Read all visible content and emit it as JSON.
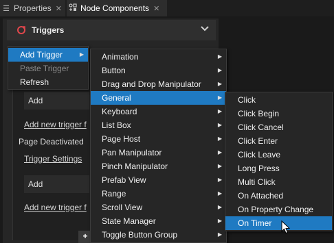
{
  "tabs": [
    {
      "label": "Properties",
      "icon": "list-icon",
      "close": "✕"
    },
    {
      "label": "Node Components",
      "icon": "node-components-icon",
      "close": "✕"
    }
  ],
  "section": {
    "title": "Triggers",
    "icon": "trigger-icon"
  },
  "panel": {
    "add_label_1": "Add",
    "add_new_trigger_1": "Add new trigger f",
    "page_deactivated": "Page Deactivated",
    "trigger_settings": "Trigger Settings",
    "add_label_2": "Add",
    "add_new_trigger_2": "Add new trigger f",
    "add_button": "+"
  },
  "context_menu": {
    "items": [
      {
        "label": "Add Trigger",
        "selected": true,
        "submenu": true
      },
      {
        "label": "Paste Trigger",
        "disabled": true
      },
      {
        "label": "Refresh"
      }
    ]
  },
  "trigger_menu": {
    "items": [
      "Animation",
      "Button",
      "Drag and Drop Manipulator",
      "General",
      "Keyboard",
      "List Box",
      "Page Host",
      "Pan Manipulator",
      "Pinch Manipulator",
      "Prefab View",
      "Range",
      "Scroll View",
      "State Manager",
      "Toggle Button Group"
    ],
    "selected": "General"
  },
  "general_menu": {
    "items": [
      "Click",
      "Click Begin",
      "Click Cancel",
      "Click Enter",
      "Click Leave",
      "Long Press",
      "Multi Click",
      "On Attached",
      "On Property Change",
      "On Timer"
    ],
    "selected": "On Timer"
  },
  "colors": {
    "selection": "#1f7ac2",
    "background": "#262626",
    "trigger_icon": "#e0474c"
  }
}
